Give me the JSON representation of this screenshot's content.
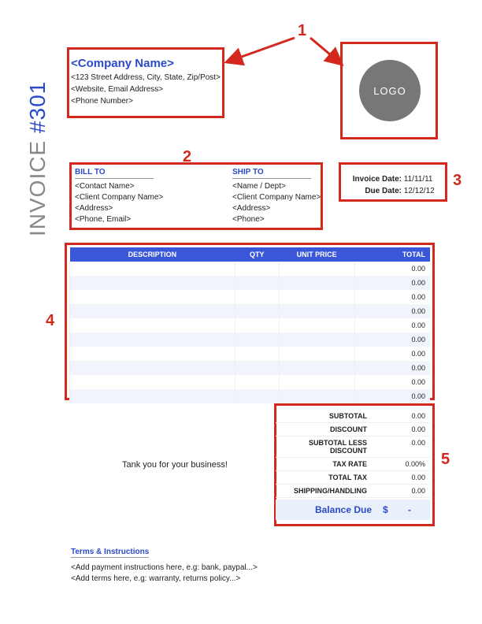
{
  "callouts": {
    "n1": "1",
    "n2": "2",
    "n3": "3",
    "n4": "4",
    "n5": "5"
  },
  "company": {
    "name": "<Company Name>",
    "address": "<123 Street Address, City, State, Zip/Post>",
    "web_email": "<Website, Email Address>",
    "phone": "<Phone Number>"
  },
  "logo_text": "LOGO",
  "invoice_label": "INVOICE ",
  "invoice_number": "#301",
  "bill_to": {
    "header": "BILL TO",
    "contact": "<Contact Name>",
    "company": "<Client Company Name>",
    "address": "<Address>",
    "phone_email": "<Phone, Email>"
  },
  "ship_to": {
    "header": "SHIP TO",
    "name_dept": "<Name / Dept>",
    "company": "<Client Company Name>",
    "address": "<Address>",
    "phone": "<Phone>"
  },
  "dates": {
    "invoice_label": "Invoice Date:",
    "invoice_value": "11/11/11",
    "due_label": "Due Date:",
    "due_value": "12/12/12"
  },
  "table": {
    "headers": {
      "description": "DESCRIPTION",
      "qty": "QTY",
      "unit_price": "UNIT PRICE",
      "total": "TOTAL"
    },
    "rows": [
      {
        "total": "0.00"
      },
      {
        "total": "0.00"
      },
      {
        "total": "0.00"
      },
      {
        "total": "0.00"
      },
      {
        "total": "0.00"
      },
      {
        "total": "0.00"
      },
      {
        "total": "0.00"
      },
      {
        "total": "0.00"
      },
      {
        "total": "0.00"
      },
      {
        "total": "0.00"
      }
    ]
  },
  "thank_you": "Tank you for your business!",
  "totals": {
    "subtotal": {
      "label": "SUBTOTAL",
      "value": "0.00"
    },
    "discount": {
      "label": "DISCOUNT",
      "value": "0.00"
    },
    "subtotal_less": {
      "label": "SUBTOTAL LESS DISCOUNT",
      "value": "0.00"
    },
    "tax_rate": {
      "label": "TAX RATE",
      "value": "0.00%"
    },
    "total_tax": {
      "label": "TOTAL TAX",
      "value": "0.00"
    },
    "shipping": {
      "label": "SHIPPING/HANDLING",
      "value": "0.00"
    },
    "balance": {
      "label": "Balance Due",
      "currency": "$",
      "value": "-"
    }
  },
  "terms": {
    "header": "Terms & Instructions",
    "payment": "<Add payment instructions here, e.g: bank, paypal...>",
    "other": "<Add terms here, e.g: warranty, returns policy...>"
  }
}
